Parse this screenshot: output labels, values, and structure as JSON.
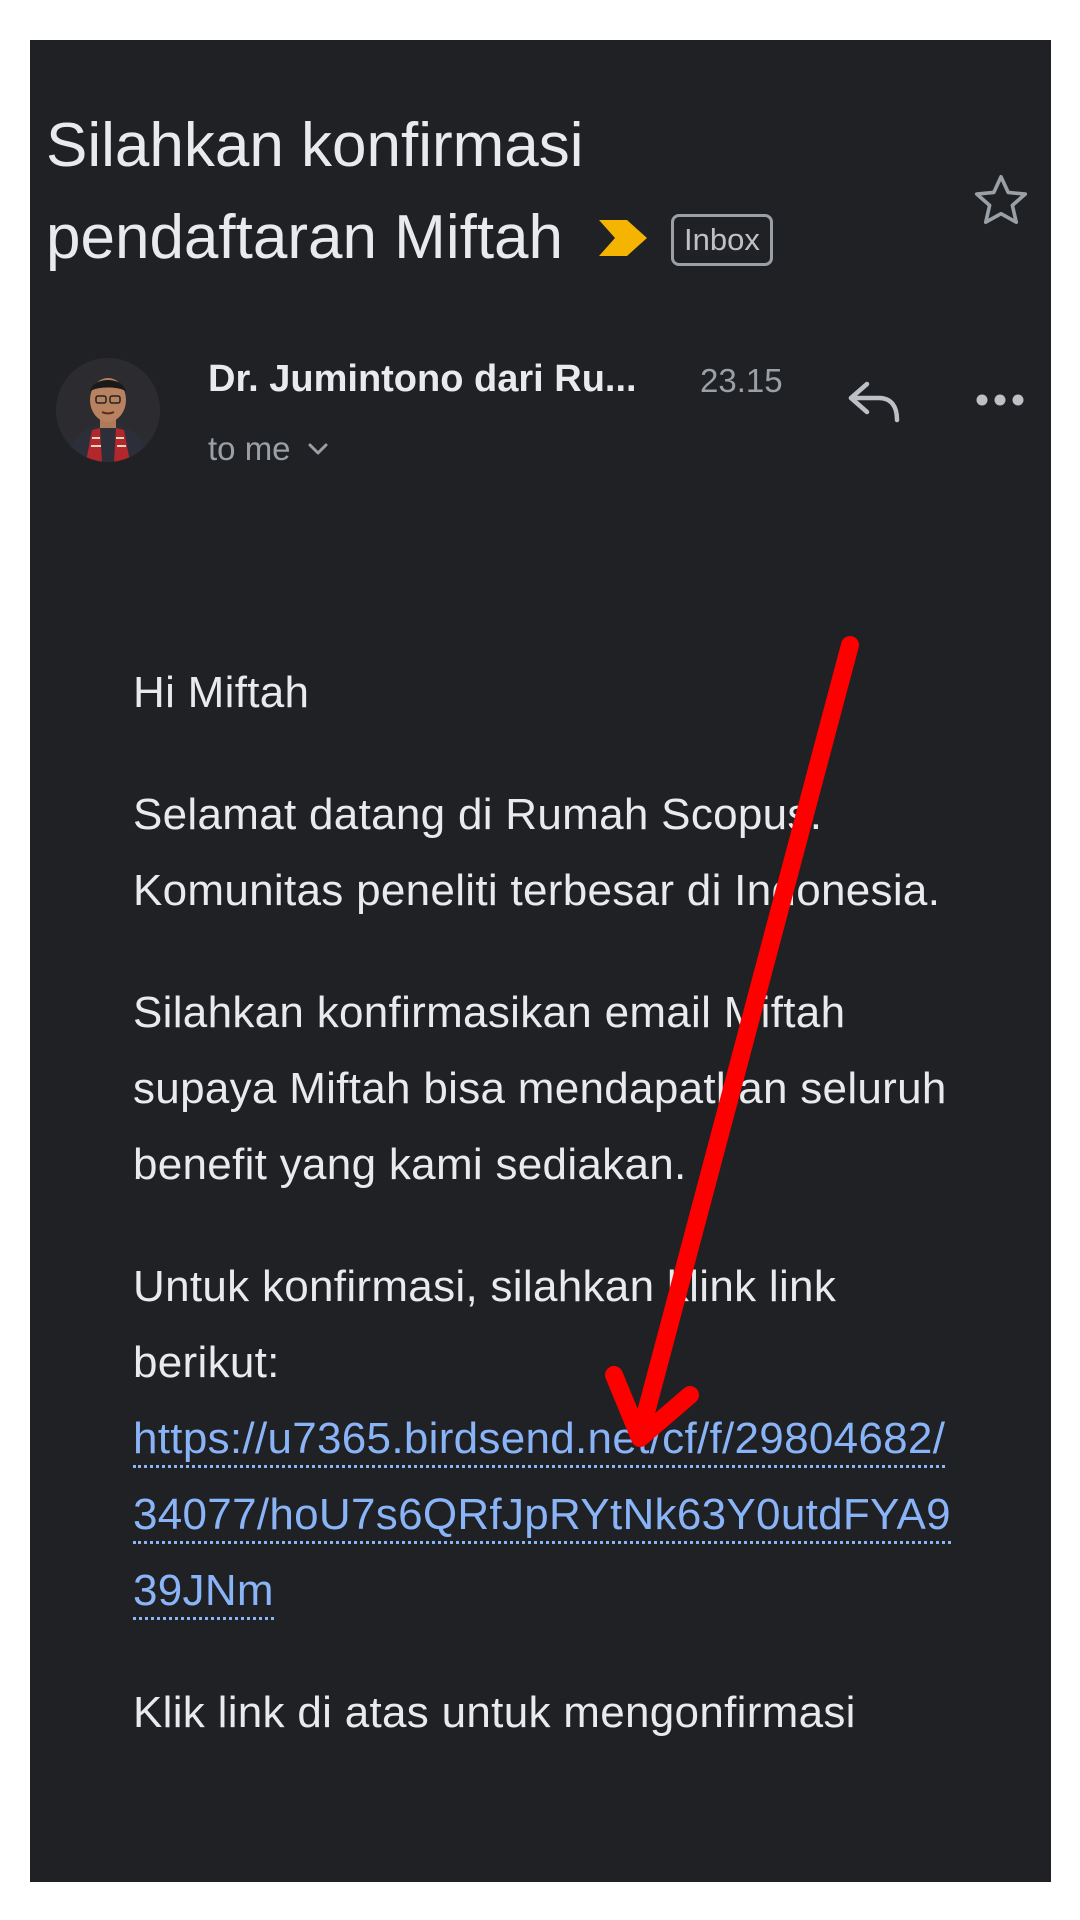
{
  "email": {
    "subject_line1": "Silahkan konfirmasi",
    "subject_line2": "pendaftaran Miftah",
    "label": "Inbox",
    "sender": "Dr. Jumintono dari Ru...",
    "time": "23.15",
    "recipient": "to me"
  },
  "body": {
    "greeting": "Hi Miftah",
    "para1": "Selamat datang di Rumah Scopus. Komunitas peneliti terbesar di Indonesia.",
    "para2": "Silahkan konfirmasikan email Miftah supaya Miftah bisa mendapatkan seluruh benefit yang kami sediakan.",
    "para3": "Untuk konfirmasi, silahkan klink link berikut:",
    "link": "https://u7365.birdsend.net/cf/f/29804682/34077/hoU7s6QRfJpRYtNk63Y0utdFYA939JNm",
    "para4": "Klik link di atas untuk mengonfirmasi"
  },
  "icons": {
    "importance": "label-important-icon",
    "star": "star-outline-icon",
    "reply": "reply-icon",
    "more": "more-horiz-icon",
    "chevron": "chevron-down-icon",
    "annotation": "red-arrow-annotation"
  },
  "colors": {
    "background": "#202124",
    "text": "#e8eaed",
    "secondary": "#9aa0a6",
    "link": "#8ab4f8",
    "importance": "#f4b400",
    "annotation": "#ff0000"
  }
}
